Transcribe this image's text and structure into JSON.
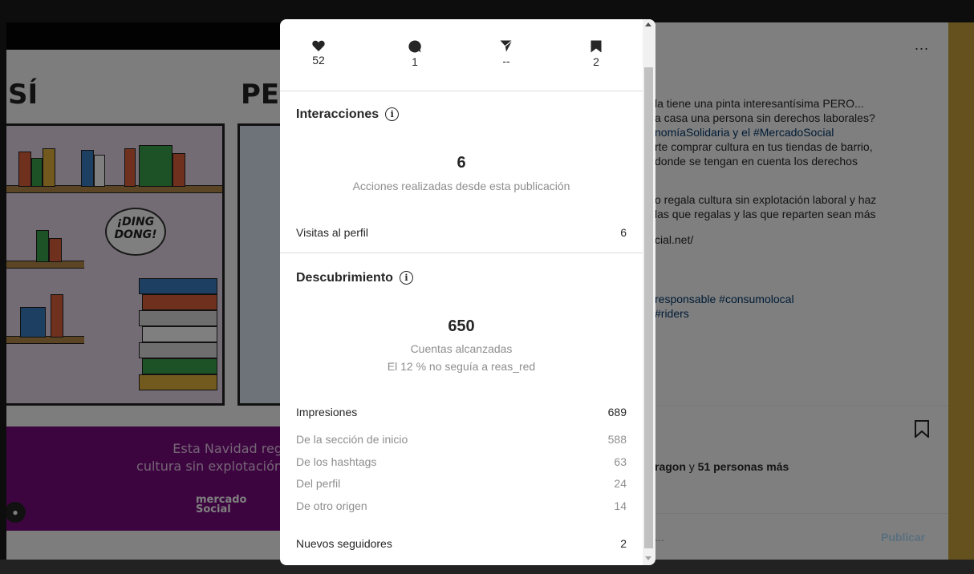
{
  "background": {
    "post_image": {
      "word_left": "SÍ",
      "word_right": "PE",
      "bubble_text_1": "¡DING",
      "bubble_text_2": "DONG!",
      "band_line_1": "Esta Navidad reg",
      "band_line_2": "cultura sin explotación",
      "logo_line_1": "mercado",
      "logo_line_2": "Social"
    },
    "caption_lines": [
      "la tiene una pinta interesantísima PERO...",
      "a casa una persona sin derechos laborales?",
      "nomíaSolidaria y el #MercadoSocial",
      "rte comprar cultura en tus tiendas de barrio,",
      "donde se tengan en cuenta los derechos",
      "o regala cultura sin explotación laboral y haz",
      "las que regalas y las que reparten sean más",
      "cial.net/",
      "responsable #consumolocal",
      "#riders"
    ],
    "more_label": "...",
    "likes_prefix": "ragon",
    "likes_connector": " y ",
    "likes_suffix": "51 personas más",
    "comment_placeholder": "...",
    "publish_label": "Publicar"
  },
  "insights": {
    "stats": {
      "likes": "52",
      "comments": "1",
      "shares": "--",
      "saves": "2"
    },
    "interactions": {
      "title": "Interacciones",
      "info": "i",
      "total": "6",
      "total_label": "Acciones realizadas desde esta publicación",
      "profile_visits_label": "Visitas al perfil",
      "profile_visits_value": "6"
    },
    "discovery": {
      "title": "Descubrimiento",
      "info": "i",
      "reach": "650",
      "reach_label": "Cuentas alcanzadas",
      "reach_note": "El 12 % no seguía a reas_red",
      "impressions_label": "Impresiones",
      "impressions_value": "689",
      "sources": [
        {
          "label": "De la sección de inicio",
          "value": "588"
        },
        {
          "label": "De los hashtags",
          "value": "63"
        },
        {
          "label": "Del perfil",
          "value": "24"
        },
        {
          "label": "De otro origen",
          "value": "14"
        }
      ],
      "new_followers_label": "Nuevos seguidores",
      "new_followers_value": "2"
    }
  }
}
